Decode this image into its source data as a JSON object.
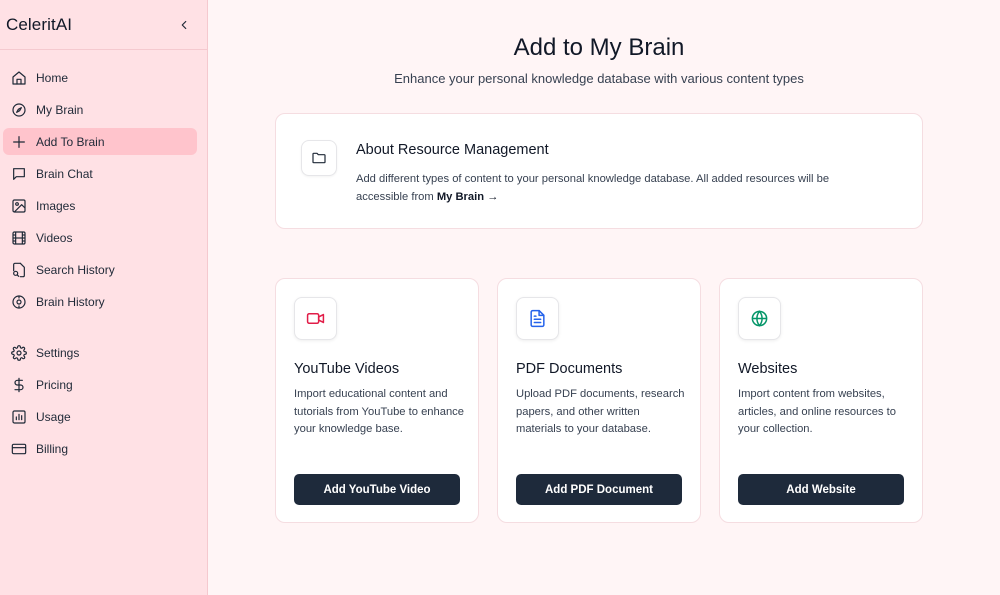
{
  "sidebar": {
    "brand": "CeleritAI",
    "items": [
      {
        "label": "Home",
        "icon": "home-icon"
      },
      {
        "label": "My Brain",
        "icon": "compass-icon"
      },
      {
        "label": "Add To Brain",
        "icon": "plus-icon",
        "active": true
      },
      {
        "label": "Brain Chat",
        "icon": "message-square-icon"
      },
      {
        "label": "Images",
        "icon": "image-icon"
      },
      {
        "label": "Videos",
        "icon": "film-icon"
      },
      {
        "label": "Search History",
        "icon": "file-search-icon"
      },
      {
        "label": "Brain History",
        "icon": "compass-icon"
      },
      {
        "label": "Settings",
        "icon": "gear-icon"
      },
      {
        "label": "Pricing",
        "icon": "dollar-icon"
      },
      {
        "label": "Usage",
        "icon": "bar-chart-icon"
      },
      {
        "label": "Billing",
        "icon": "credit-card-icon"
      }
    ]
  },
  "main": {
    "title": "Add to My Brain",
    "subtitle": "Enhance your personal knowledge database with various content types",
    "about": {
      "title": "About Resource Management",
      "text": "Add different types of content to your personal knowledge database. All added resources will be accessible from",
      "link": "My Brain →"
    },
    "cards": [
      {
        "title": "YouTube Videos",
        "description": "Import educational content and tutorials from YouTube to enhance your knowledge base.",
        "button": "Add YouTube Video",
        "icon": "video-icon",
        "color": "#e11d48"
      },
      {
        "title": "PDF Documents",
        "description": "Upload PDF documents, research papers, and other written materials to your database.",
        "button": "Add PDF Document",
        "icon": "file-text-icon",
        "color": "#2563eb"
      },
      {
        "title": "Websites",
        "description": "Import content from websites, articles, and online resources to your collection.",
        "button": "Add Website",
        "icon": "globe-icon",
        "color": "#059669"
      }
    ]
  },
  "colors": {
    "sidebar_bg": "#ffe1e5",
    "active_item": "#ffc4cc",
    "page_bg": "#fff5f6",
    "button_bg": "#1e2a3b"
  }
}
